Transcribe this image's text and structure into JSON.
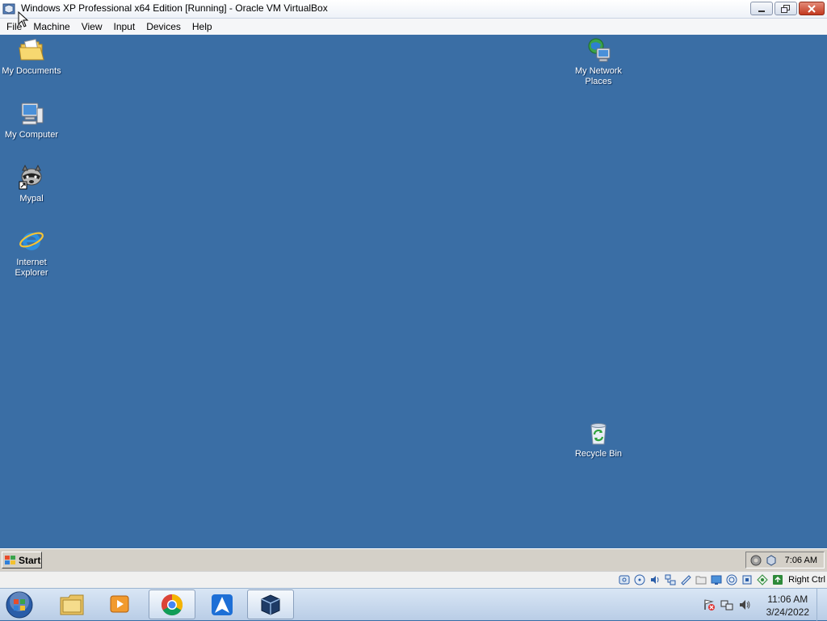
{
  "window": {
    "title": "Windows XP Professional x64 Edition [Running] - Oracle VM VirtualBox",
    "controls": [
      "minimize",
      "restore",
      "close"
    ]
  },
  "menu": {
    "items": [
      "File",
      "Machine",
      "View",
      "Input",
      "Devices",
      "Help"
    ]
  },
  "desktop": {
    "background": "#3a6ea5",
    "icons": {
      "my_documents": "My Documents",
      "my_computer": "My Computer",
      "mypal_label": "Mypal",
      "internet_explorer": "Internet Explorer",
      "network_places": "My Network Places",
      "recycle_bin": "Recycle Bin"
    }
  },
  "guest_taskbar": {
    "start_label": "Start",
    "clock": "7:06 AM"
  },
  "vbox_status": {
    "indicators": [
      "hard-disk-icon",
      "optical-drive-icon",
      "audio-icon",
      "network-icon",
      "usb-icon",
      "shared-folders-icon",
      "display-icon",
      "video-capture-icon",
      "cpu-icon",
      "mouse-integration-icon",
      "keyboard-icon"
    ],
    "host_key": "Right Ctrl"
  },
  "host_taskbar": {
    "pinned": [
      "start-orb-icon",
      "file-explorer-icon",
      "media-player-icon",
      "chrome-icon",
      "arch-icon",
      "virtualbox-icon"
    ],
    "time": "11:06 AM",
    "date": "3/24/2022"
  }
}
